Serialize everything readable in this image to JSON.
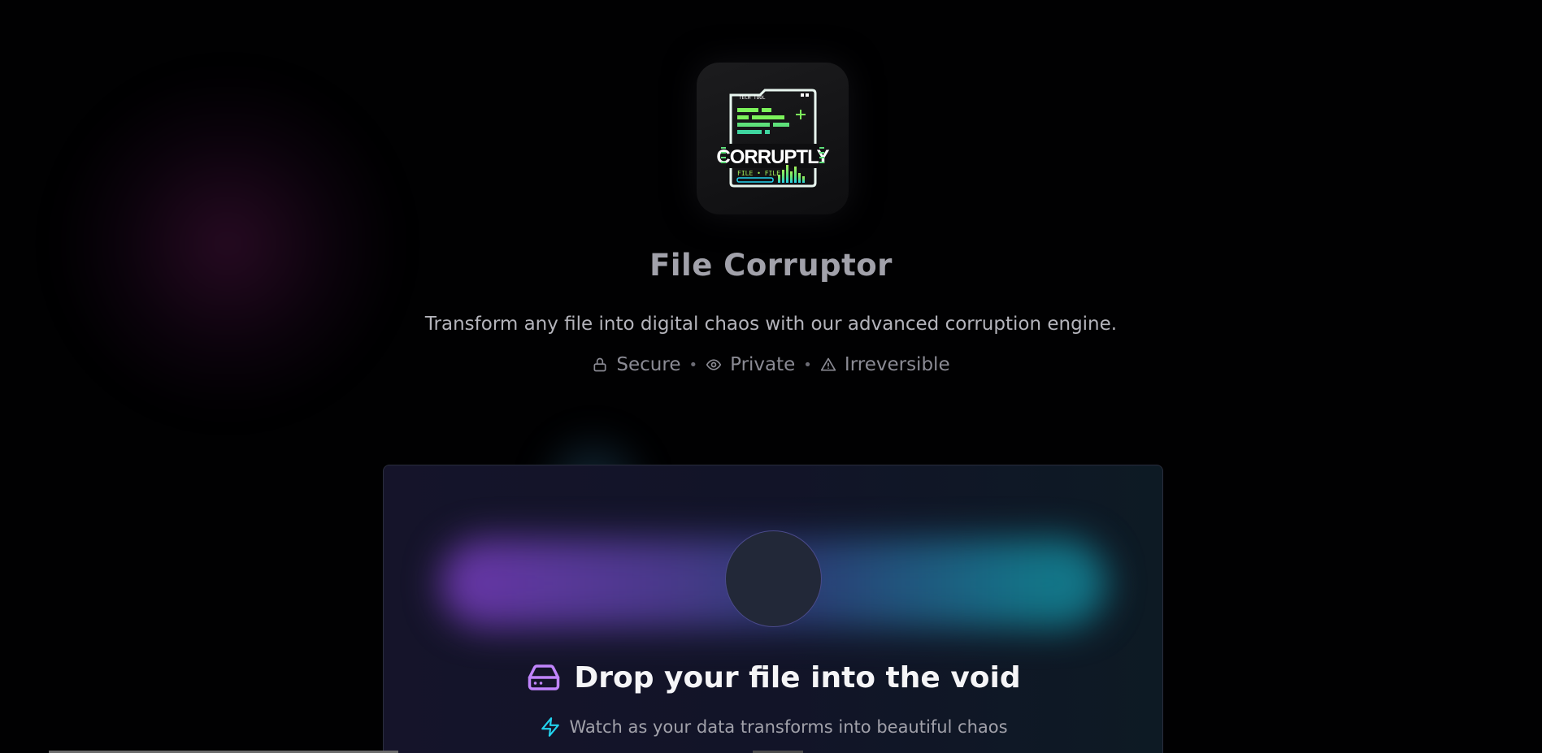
{
  "header": {
    "logo_icon": "corruptly-logo-icon",
    "logo_text": "CORRUPTLY",
    "logo_small_text": "TECH TOOL",
    "logo_footer_text": "FILE • FILE",
    "title": "File Corruptor",
    "subtitle": "Transform any file into digital chaos with our advanced corruption engine.",
    "features": [
      {
        "icon": "lock-icon",
        "label": "Secure"
      },
      {
        "icon": "eye-icon",
        "label": "Private"
      },
      {
        "icon": "warning-icon",
        "label": "Irreversible"
      }
    ],
    "separator": "•"
  },
  "dropzone": {
    "title_icon": "hard-drive-icon",
    "title": "Drop your file into the void",
    "subtitle_icon": "lightning-icon",
    "subtitle": "Watch as your data transforms into beautiful chaos"
  },
  "colors": {
    "background": "#000000",
    "accent_purple": "#a855f7",
    "accent_cyan": "#22d3ee",
    "logo_green": "#7cf35b"
  }
}
